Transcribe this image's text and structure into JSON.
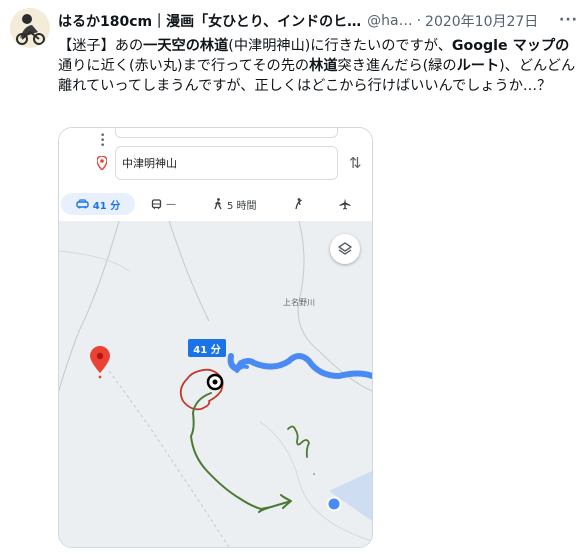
{
  "tweet": {
    "display_name": "はるか180cm｜漫画「女ひとり、インドのヒ…",
    "handle": "@ha…",
    "separator": "·",
    "date": "2020年10月27日",
    "more_label": "···",
    "text_segments": [
      {
        "text": "【迷子】あの",
        "bold": false
      },
      {
        "text": "一天空の林道",
        "bold": true
      },
      {
        "text": "(中津明神山)に行きたいのですが、",
        "bold": false
      },
      {
        "text": "Google マップの",
        "bold": true
      },
      {
        "text": "通りに近く(赤い丸)まで行ってその先の",
        "bold": false
      },
      {
        "text": "林道",
        "bold": true
      },
      {
        "text": "突き進んだら(緑の",
        "bold": false
      },
      {
        "text": "ルート",
        "bold": false
      },
      {
        "text": ")、どんどん離れていってしまうんですが、正しくはどこから行けばいいんでしょうか…？",
        "bold": false
      }
    ]
  },
  "map": {
    "destination": "中津明神山",
    "modes": [
      {
        "name": "car",
        "label": "41 分"
      },
      {
        "name": "transit",
        "label": "—"
      },
      {
        "name": "walk",
        "label": "5 時間"
      },
      {
        "name": "ride",
        "label": ""
      },
      {
        "name": "flight",
        "label": ""
      }
    ],
    "place_label": "上名野川",
    "time_badge": "41 分",
    "colors": {
      "route_blue": "#4a8af4",
      "annotation_red": "#c0392b",
      "annotation_green": "#4b7a34",
      "pin_red": "#ea4335",
      "accent": "#1a73e8"
    }
  }
}
